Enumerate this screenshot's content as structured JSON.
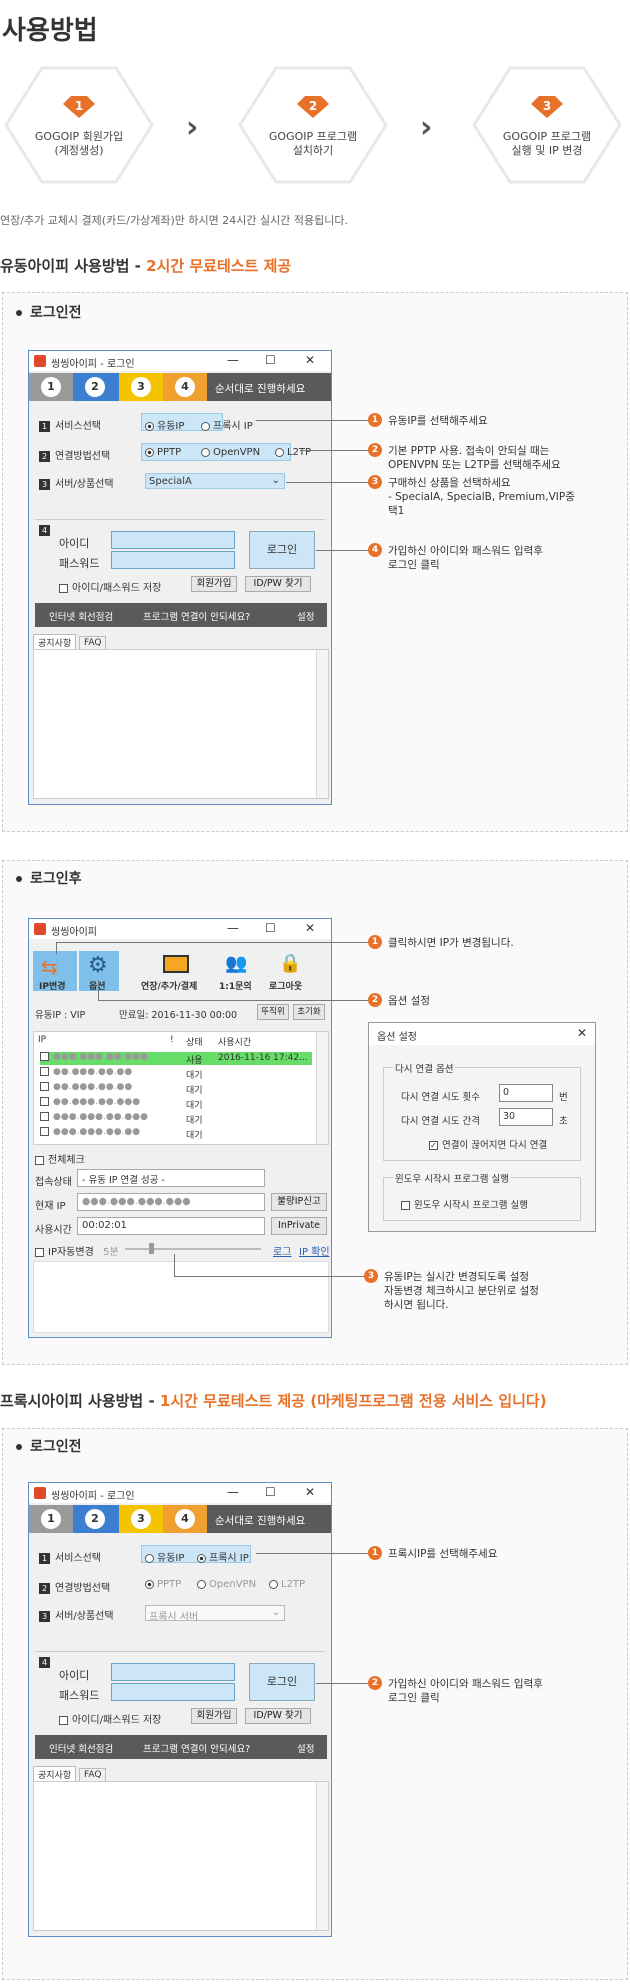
{
  "page_title": "사용방법",
  "steps": [
    {
      "num": "1",
      "line1": "GOGOIP 회원가입",
      "line2": "(계정생성)"
    },
    {
      "num": "2",
      "line1": "GOGOIP 프로그램",
      "line2": "설치하기"
    },
    {
      "num": "3",
      "line1": "GOGOIP 프로그램",
      "line2": "실행 및 IP 변경"
    }
  ],
  "notice": "연장/추가 교체시 결제(카드/가상계좌)만 하시면 24시간 실시간 적용됩니다.",
  "section1": {
    "title": "유동아이피 사용방법 - ",
    "highlight": "2시간 무료테스트 제공"
  },
  "section2": {
    "title": "프록시아이피 사용방법 - ",
    "highlight": "1시간 무료테스트 제공 (마케팅프로그램 전용 서비스 입니다)"
  },
  "login_before": "로그인전",
  "login_after": "로그인후",
  "login_window": {
    "title": "씽씽아이피 - 로그인",
    "step_nums": [
      "1",
      "2",
      "3",
      "4"
    ],
    "step_text": "순서대로 진행하세요",
    "row1_label": "서비스선택",
    "row1_num": "1",
    "row2_label": "연결방법선택",
    "row2_num": "2",
    "row3_label": "서버/상품선택",
    "row3_num": "3",
    "opt_dynamic": "유동IP",
    "opt_proxy": "프록시 IP",
    "opt_pptp": "PPTP",
    "opt_openvpn": "OpenVPN",
    "opt_l2tp": "L2TP",
    "server_value": "SpecialA",
    "server_value_proxy": "프록시 서버",
    "box_num": "4",
    "id_label": "아이디",
    "pw_label": "패스워드",
    "login_btn": "로그인",
    "save_label": "아이디/패스워드 저장",
    "join_btn": "회원가입",
    "find_btn": "ID/PW 찾기",
    "bar_items": [
      "인터넷 회선점검",
      "프로그램 연결이 안되세요?",
      "설정"
    ],
    "tabs": [
      "공지사항",
      "FAQ"
    ]
  },
  "callouts1": [
    {
      "n": "1",
      "text": "유동IP를 선택해주세요"
    },
    {
      "n": "2",
      "text": "기본 PPTP 사용. 접속이 안되실 때는",
      "text2": "OPENVPN 또는 L2TP를 선택해주세요"
    },
    {
      "n": "3",
      "text": "구매하신 상품을 선택하세요",
      "text2": "- SpecialA, SpecialB, Premium,VIP중",
      "text3": "택1"
    },
    {
      "n": "4",
      "text": "가입하신 아이디와 패스워드 입력후",
      "text2": "로그인 클릭"
    }
  ],
  "main_window": {
    "title": "씽씽아이피",
    "tools": [
      "IP변경",
      "옵션",
      "연장/추가/결제",
      "1:1문의",
      "로그아웃"
    ],
    "info_left": "유동IP : VIP",
    "info_right": "만료일: 2016-11-30 00:00",
    "btn_tune": "뚜직위",
    "btn_reset": "초기화",
    "cols": [
      "IP",
      "!",
      "상태",
      "사용시간"
    ],
    "rows": [
      {
        "ip": "●●●.●●●.●●.●●●",
        "status": "사용",
        "time": "2016-11-16 17:42..."
      },
      {
        "ip": "●●.●●●.●●.●●",
        "status": "대기",
        "time": ""
      },
      {
        "ip": "●●.●●●.●●.●●",
        "status": "대기",
        "time": ""
      },
      {
        "ip": "●●.●●●.●●.●●●",
        "status": "대기",
        "time": ""
      },
      {
        "ip": "●●●.●●●.●●.●●●",
        "status": "대기",
        "time": ""
      },
      {
        "ip": "●●●.●●●.●●.●●",
        "status": "대기",
        "time": ""
      }
    ],
    "select_all": "전체체크",
    "conn_label": "접속상태",
    "conn_value": "- 유동 IP 연결 성공 -",
    "ip_label": "현재 IP",
    "ip_value": "●●●.●●●.●●●.●●●",
    "bad_ip_btn": "불량IP신고",
    "time_label": "사용시간",
    "time_value": "00:02:01",
    "inprivate_btn": "InPrivate",
    "auto_label": "IP자동변경",
    "auto_value": "5분",
    "link_log": "로그",
    "link_ip": "IP 확인"
  },
  "options_dialog": {
    "title": "옵션 설정",
    "group1": "다시 연결 옵션",
    "retry_count_label": "다시 연결 시도 횟수",
    "retry_count": "0",
    "retry_count_unit": "번",
    "retry_interval_label": "다시 연결 시도 간격",
    "retry_interval": "30",
    "retry_interval_unit": "초",
    "reconnect_label": "연결이 끊어지면 다시 연결",
    "group2": "윈도우 시작시 프로그램 실행",
    "startup_label": "윈도우 시작시 프로그램 실행"
  },
  "callouts2": [
    {
      "n": "1",
      "text": "클릭하시면 IP가 변경됩니다."
    },
    {
      "n": "2",
      "text": "옵션 설정"
    },
    {
      "n": "3",
      "text": "유동IP는 실시간 변경되도록 설정",
      "text2": "자동변경 체크하시고 분단위로 설정",
      "text3": "하시면 됩니다."
    }
  ],
  "callouts3": [
    {
      "n": "1",
      "text": "프록시IP를 선택해주세요"
    },
    {
      "n": "2",
      "text": "가입하신 아이디와 패스워드 입력후",
      "text2": "로그인 클릭"
    }
  ]
}
